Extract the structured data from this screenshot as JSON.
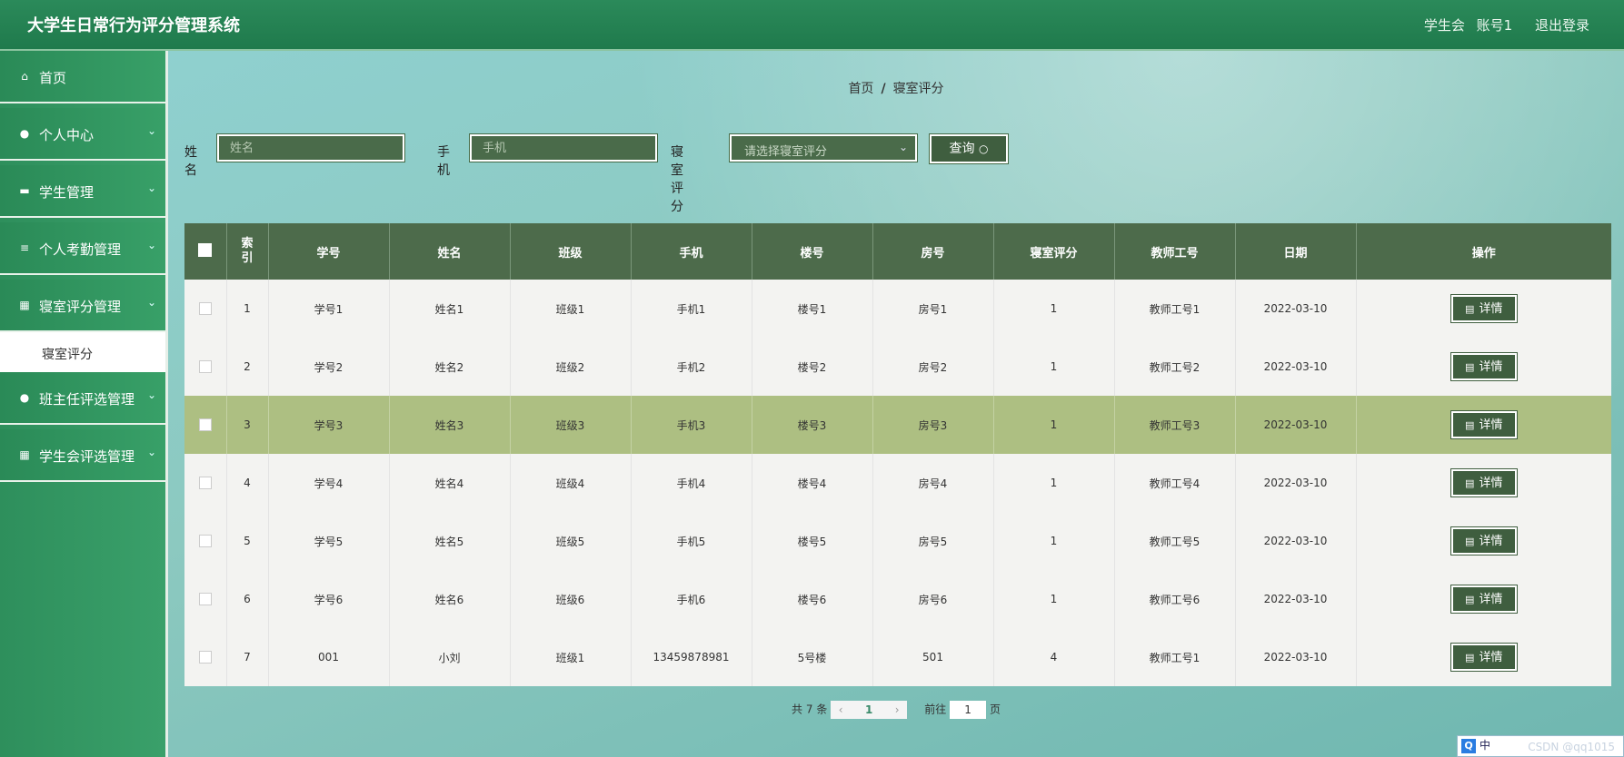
{
  "header": {
    "title": "大学生日常行为评分管理系统",
    "role": "学生会",
    "account": "账号1",
    "logout": "退出登录"
  },
  "sidebar": {
    "items": [
      {
        "label": "首页",
        "icon": "home-icon"
      },
      {
        "label": "个人中心",
        "icon": "user-icon"
      },
      {
        "label": "学生管理",
        "icon": "ticket-icon"
      },
      {
        "label": "个人考勤管理",
        "icon": "sliders-icon"
      },
      {
        "label": "寝室评分管理",
        "icon": "grid-icon"
      },
      {
        "label": "班主任评选管理",
        "icon": "user-icon"
      },
      {
        "label": "学生会评选管理",
        "icon": "grid-icon"
      }
    ],
    "subitem": "寝室评分"
  },
  "breadcrumb": {
    "home": "首页",
    "sep": "/",
    "current": "寝室评分"
  },
  "search": {
    "name_label": "姓名",
    "name_placeholder": "姓名",
    "phone_label": "手机",
    "phone_placeholder": "手机",
    "score_label": "寝室评分",
    "score_placeholder": "请选择寝室评分",
    "query_button": "查询"
  },
  "table": {
    "columns": [
      "索引",
      "学号",
      "姓名",
      "班级",
      "手机",
      "楼号",
      "房号",
      "寝室评分",
      "教师工号",
      "日期",
      "操作"
    ],
    "detail_label": "详情",
    "rows": [
      [
        "1",
        "学号1",
        "姓名1",
        "班级1",
        "手机1",
        "楼号1",
        "房号1",
        "1",
        "教师工号1",
        "2022-03-10"
      ],
      [
        "2",
        "学号2",
        "姓名2",
        "班级2",
        "手机2",
        "楼号2",
        "房号2",
        "1",
        "教师工号2",
        "2022-03-10"
      ],
      [
        "3",
        "学号3",
        "姓名3",
        "班级3",
        "手机3",
        "楼号3",
        "房号3",
        "1",
        "教师工号3",
        "2022-03-10"
      ],
      [
        "4",
        "学号4",
        "姓名4",
        "班级4",
        "手机4",
        "楼号4",
        "房号4",
        "1",
        "教师工号4",
        "2022-03-10"
      ],
      [
        "5",
        "学号5",
        "姓名5",
        "班级5",
        "手机5",
        "楼号5",
        "房号5",
        "1",
        "教师工号5",
        "2022-03-10"
      ],
      [
        "6",
        "学号6",
        "姓名6",
        "班级6",
        "手机6",
        "楼号6",
        "房号6",
        "1",
        "教师工号6",
        "2022-03-10"
      ],
      [
        "7",
        "001",
        "小刘",
        "班级1",
        "13459878981",
        "5号楼",
        "501",
        "4",
        "教师工号1",
        "2022-03-10"
      ]
    ],
    "highlighted_row": 3
  },
  "pager": {
    "total_prefix": "共",
    "total": "7",
    "total_suffix": "条",
    "current_page": "1",
    "goto_prefix": "前往",
    "goto_value": "1",
    "goto_suffix": "页"
  },
  "ime": {
    "q": "Q",
    "mode": "中"
  },
  "watermark": "CSDN @qq1015"
}
